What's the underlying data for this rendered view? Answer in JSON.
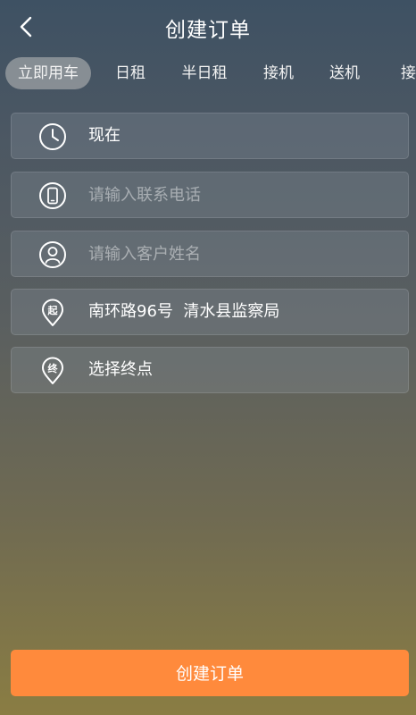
{
  "header": {
    "title": "创建订单"
  },
  "tabs": [
    {
      "label": "立即用车"
    },
    {
      "label": "日租"
    },
    {
      "label": "半日租"
    },
    {
      "label": "接机"
    },
    {
      "label": "送机"
    },
    {
      "label": "接站"
    }
  ],
  "form": {
    "time": {
      "value": "现在",
      "icon": "clock-icon"
    },
    "phone": {
      "placeholder": "请输入联系电话",
      "icon": "phone-icon"
    },
    "name": {
      "placeholder": "请输入客户姓名",
      "icon": "user-icon"
    },
    "start": {
      "value": "南环路96号  清水县监察局",
      "icon": "start-pin-icon",
      "icon_label": "起"
    },
    "end": {
      "value": "选择终点",
      "icon": "end-pin-icon",
      "icon_label": "终"
    }
  },
  "submit": {
    "label": "创建订单"
  },
  "colors": {
    "accent": "#ff8a3c"
  }
}
